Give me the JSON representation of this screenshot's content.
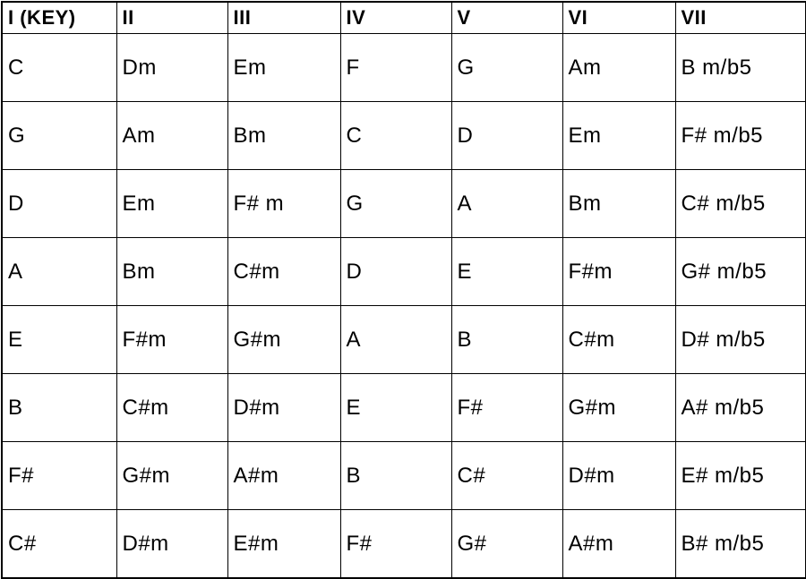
{
  "chart_data": {
    "type": "table",
    "title": "",
    "columns": [
      "I (KEY)",
      "II",
      "III",
      "IV",
      "V",
      "VI",
      "VII"
    ],
    "rows": [
      [
        "C",
        "Dm",
        "Em",
        "F",
        "G",
        "Am",
        "B m/b5"
      ],
      [
        "G",
        "Am",
        "Bm",
        "C",
        "D",
        "Em",
        "F# m/b5"
      ],
      [
        "D",
        "Em",
        "F# m",
        "G",
        "A",
        "Bm",
        "C# m/b5"
      ],
      [
        "A",
        "Bm",
        "C#m",
        "D",
        "E",
        "F#m",
        "G# m/b5"
      ],
      [
        "E",
        "F#m",
        "G#m",
        "A",
        "B",
        "C#m",
        "D# m/b5"
      ],
      [
        "B",
        "C#m",
        "D#m",
        "E",
        "F#",
        "G#m",
        "A# m/b5"
      ],
      [
        "F#",
        "G#m",
        "A#m",
        "B",
        "C#",
        "D#m",
        "E# m/b5"
      ],
      [
        "C#",
        "D#m",
        "E#m",
        "F#",
        "G#",
        "A#m",
        "B# m/b5"
      ]
    ]
  }
}
